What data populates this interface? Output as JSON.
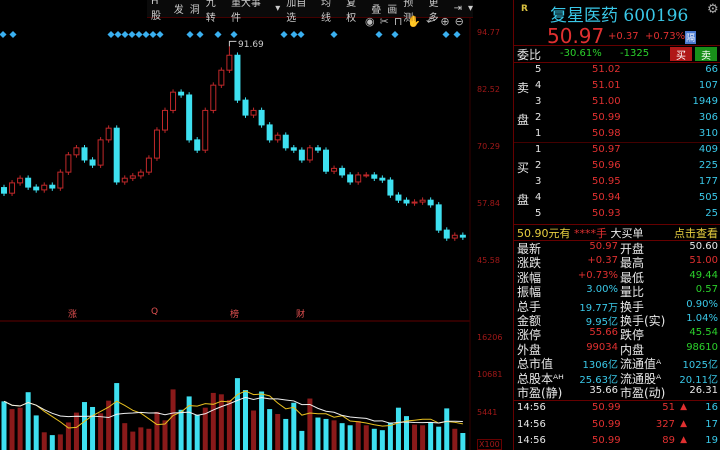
{
  "toolbar": {
    "items": [
      "H股",
      "发",
      "洞",
      "九转",
      "重大事件",
      "▾",
      "加自选",
      "均线",
      "复权",
      "叠",
      "画",
      "预测",
      "更多",
      "⇥",
      "▾"
    ]
  },
  "chart_icons": [
    "eye-icon",
    "scissors-icon",
    "lock-icon",
    "hand-icon",
    "undo-icon",
    "zoom-in-icon",
    "zoom-out-icon"
  ],
  "chart": {
    "price_axis": [
      "94.77",
      "82.52",
      "70.29",
      "57.84",
      "45.58"
    ],
    "volume_axis": [
      "16206",
      "10681",
      "5441",
      "X100"
    ],
    "peak_label": "91.69",
    "event_labels": [
      "涨",
      "Q",
      "榜",
      "财"
    ],
    "colors": {
      "up": "#c0282a",
      "down": "#3ee0f0",
      "ma5": "#f0f0f0",
      "ma10": "#e8c020",
      "grid": "#600000"
    }
  },
  "chart_data": {
    "type": "candlestick",
    "price_ylim": [
      45.58,
      94.77
    ],
    "volume_ylim": [
      0,
      16206
    ],
    "ohlc": [
      [
        61.5,
        62.1,
        59.7,
        60.3
      ],
      [
        60.3,
        63.1,
        59.7,
        62.5
      ],
      [
        62.5,
        64.1,
        61.9,
        63.5
      ],
      [
        63.5,
        64.1,
        61.0,
        61.6
      ],
      [
        61.6,
        62.2,
        60.4,
        61.0
      ],
      [
        61.0,
        62.6,
        60.4,
        62.0
      ],
      [
        62.0,
        62.6,
        60.8,
        61.4
      ],
      [
        61.4,
        65.4,
        60.8,
        64.8
      ],
      [
        64.8,
        69.1,
        64.2,
        68.5
      ],
      [
        68.5,
        70.6,
        67.9,
        70.0
      ],
      [
        70.0,
        70.6,
        66.8,
        67.4
      ],
      [
        67.4,
        68.0,
        65.7,
        66.3
      ],
      [
        66.3,
        72.3,
        65.7,
        71.7
      ],
      [
        71.7,
        74.8,
        71.1,
        74.2
      ],
      [
        74.2,
        74.8,
        62.1,
        62.7
      ],
      [
        62.7,
        64.1,
        62.1,
        63.5
      ],
      [
        63.5,
        64.6,
        62.9,
        64.0
      ],
      [
        64.0,
        65.4,
        63.4,
        64.8
      ],
      [
        64.8,
        68.4,
        64.2,
        67.8
      ],
      [
        67.8,
        74.4,
        67.2,
        73.8
      ],
      [
        73.8,
        78.6,
        73.2,
        78.0
      ],
      [
        78.0,
        82.5,
        77.4,
        81.9
      ],
      [
        81.9,
        82.5,
        80.7,
        81.3
      ],
      [
        81.3,
        81.9,
        71.1,
        71.7
      ],
      [
        71.7,
        72.3,
        68.9,
        69.5
      ],
      [
        69.5,
        78.6,
        68.9,
        78.0
      ],
      [
        78.0,
        84.0,
        77.4,
        83.4
      ],
      [
        83.4,
        87.2,
        82.8,
        86.6
      ],
      [
        86.6,
        91.69,
        86.0,
        89.8
      ],
      [
        89.8,
        90.4,
        79.6,
        80.2
      ],
      [
        80.2,
        80.8,
        76.4,
        77.0
      ],
      [
        77.0,
        78.6,
        76.4,
        78.0
      ],
      [
        78.0,
        78.6,
        74.3,
        74.9
      ],
      [
        74.9,
        75.5,
        71.1,
        71.7
      ],
      [
        71.7,
        73.3,
        71.1,
        72.7
      ],
      [
        72.7,
        73.3,
        69.4,
        70.0
      ],
      [
        70.0,
        70.6,
        68.9,
        69.5
      ],
      [
        69.5,
        70.1,
        66.8,
        67.4
      ],
      [
        67.4,
        70.6,
        66.8,
        70.0
      ],
      [
        70.0,
        70.6,
        68.9,
        69.5
      ],
      [
        69.5,
        70.1,
        64.4,
        65.0
      ],
      [
        65.0,
        66.2,
        64.4,
        65.6
      ],
      [
        65.6,
        66.2,
        63.6,
        64.2
      ],
      [
        64.2,
        64.8,
        62.1,
        62.7
      ],
      [
        62.7,
        64.8,
        62.1,
        64.2
      ],
      [
        64.2,
        64.8,
        63.6,
        64.2
      ],
      [
        64.2,
        64.8,
        62.9,
        63.5
      ],
      [
        63.5,
        64.1,
        62.5,
        63.1
      ],
      [
        63.1,
        63.7,
        59.3,
        59.9
      ],
      [
        59.9,
        60.5,
        58.2,
        58.8
      ],
      [
        58.8,
        59.4,
        57.6,
        58.2
      ],
      [
        58.2,
        59.0,
        57.6,
        58.4
      ],
      [
        58.4,
        59.4,
        57.8,
        58.8
      ],
      [
        58.8,
        59.4,
        57.2,
        57.8
      ],
      [
        57.8,
        58.4,
        51.8,
        52.4
      ],
      [
        52.4,
        53.0,
        50.1,
        50.7
      ],
      [
        50.7,
        51.9,
        50.1,
        51.3
      ],
      [
        51.3,
        51.9,
        50.3,
        50.9
      ]
    ],
    "volume": [
      7200,
      6100,
      6300,
      8500,
      5200,
      2800,
      2400,
      2500,
      4200,
      5600,
      7100,
      6400,
      5500,
      7300,
      9800,
      4100,
      2900,
      3500,
      3300,
      5700,
      4500,
      8900,
      6000,
      7900,
      5300,
      6300,
      8400,
      8200,
      7400,
      10500,
      8800,
      5900,
      8600,
      6100,
      5400,
      4700,
      7000,
      3000,
      7600,
      4900,
      4700,
      4500,
      4100,
      3800,
      4400,
      3800,
      3300,
      3100,
      4200,
      6300,
      5100,
      3900,
      3800,
      4200,
      3600,
      6200,
      3300,
      2700
    ]
  },
  "quote": {
    "r_label": "R",
    "name": "复星医药",
    "code": "600196",
    "price": "50.97",
    "change": "+0.37",
    "change_pct": "+0.73%",
    "tag": "隔",
    "weibi_label": "委比",
    "weibi": "-30.61%",
    "weicha": "-1325",
    "buy_btn": "买",
    "sell_btn": "卖",
    "sell_label": [
      "卖",
      "盘"
    ],
    "buy_label": [
      "买",
      "盘"
    ],
    "asks": [
      {
        "level": "5",
        "price": "51.02",
        "vol": "66"
      },
      {
        "level": "4",
        "price": "51.01",
        "vol": "107"
      },
      {
        "level": "3",
        "price": "51.00",
        "vol": "1949"
      },
      {
        "level": "2",
        "price": "50.99",
        "vol": "306"
      },
      {
        "level": "1",
        "price": "50.98",
        "vol": "310"
      }
    ],
    "bids": [
      {
        "level": "1",
        "price": "50.97",
        "vol": "409"
      },
      {
        "level": "2",
        "price": "50.96",
        "vol": "225"
      },
      {
        "level": "3",
        "price": "50.95",
        "vol": "177"
      },
      {
        "level": "4",
        "price": "50.94",
        "vol": "505"
      },
      {
        "level": "5",
        "price": "50.93",
        "vol": "25"
      }
    ],
    "bigorder": {
      "a": "50.90元有",
      "b": "****手",
      "c": "大买单",
      "d": "点击查看"
    },
    "stats": [
      {
        "l1": "最新",
        "v1": "50.97",
        "c1": "red",
        "l2": "开盘",
        "v2": "50.60",
        "c2": "white"
      },
      {
        "l1": "涨跌",
        "v1": "+0.37",
        "c1": "red",
        "l2": "最高",
        "v2": "51.00",
        "c2": "red"
      },
      {
        "l1": "涨幅",
        "v1": "+0.73%",
        "c1": "red",
        "l2": "最低",
        "v2": "49.44",
        "c2": "green"
      },
      {
        "l1": "振幅",
        "v1": "3.00%",
        "c1": "cyan",
        "l2": "量比",
        "v2": "0.57",
        "c2": "green"
      },
      {
        "l1": "总手",
        "v1": "19.77万",
        "c1": "cyan",
        "l2": "换手",
        "v2": "0.90%",
        "c2": "cyan"
      },
      {
        "l1": "金额",
        "v1": "9.95亿",
        "c1": "cyan",
        "l2": "换手(实)",
        "v2": "1.04%",
        "c2": "cyan"
      },
      {
        "l1": "涨停",
        "v1": "55.66",
        "c1": "red",
        "l2": "跌停",
        "v2": "45.54",
        "c2": "green"
      },
      {
        "l1": "外盘",
        "v1": "99034",
        "c1": "red",
        "l2": "内盘",
        "v2": "98610",
        "c2": "green"
      },
      {
        "l1": "总市值",
        "v1": "1306亿",
        "c1": "cyan",
        "l2": "流通值ᴬ",
        "v2": "1025亿",
        "c2": "cyan"
      },
      {
        "l1": "总股本ᴬᴴ",
        "v1": "25.63亿",
        "c1": "cyan",
        "l2": "流通股ᴬ",
        "v2": "20.11亿",
        "c2": "cyan"
      },
      {
        "l1": "市盈(静)",
        "v1": "35.66",
        "c1": "white",
        "l2": "市盈(动)",
        "v2": "26.31",
        "c2": "white"
      }
    ],
    "ticks": [
      {
        "time": "14:56",
        "price": "50.99",
        "vol": "51",
        "n": "16"
      },
      {
        "time": "14:56",
        "price": "50.99",
        "vol": "327",
        "n": "17"
      },
      {
        "time": "14:56",
        "price": "50.99",
        "vol": "89",
        "n": "19"
      }
    ]
  }
}
